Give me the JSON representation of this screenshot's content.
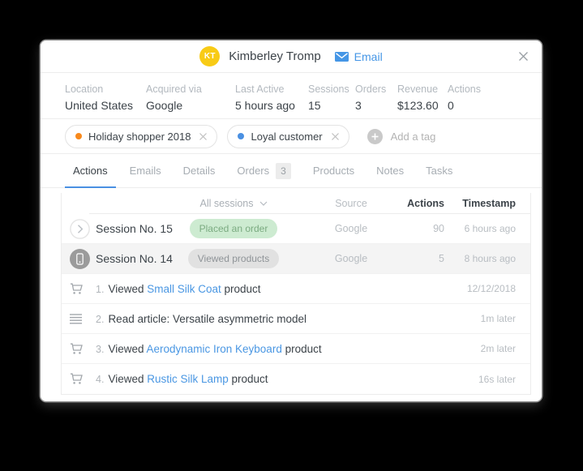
{
  "header": {
    "avatar_initials": "KT",
    "name": "Kimberley Tromp",
    "email_label": "Email"
  },
  "stats": [
    {
      "label": "Location",
      "value": "United States"
    },
    {
      "label": "Acquired via",
      "value": "Google"
    },
    {
      "label": "Last Active",
      "value": "5 hours ago"
    },
    {
      "label": "Sessions",
      "value": "15"
    },
    {
      "label": "Orders",
      "value": "3"
    },
    {
      "label": "Revenue",
      "value": "$123.60"
    },
    {
      "label": "Actions",
      "value": "0"
    }
  ],
  "tags": {
    "items": [
      {
        "label": "Holiday shopper 2018",
        "dot_color": "#f8891c"
      },
      {
        "label": "Loyal customer",
        "dot_color": "#4a90e2"
      }
    ],
    "add_label": "Add a tag"
  },
  "tabs": [
    {
      "label": "Actions",
      "active": true
    },
    {
      "label": "Emails"
    },
    {
      "label": "Details"
    },
    {
      "label": "Orders",
      "badge": "3"
    },
    {
      "label": "Products"
    },
    {
      "label": "Notes"
    },
    {
      "label": "Tasks"
    }
  ],
  "table": {
    "filter_label": "All sessions",
    "headers": {
      "source": "Source",
      "actions": "Actions",
      "timestamp": "Timestamp"
    },
    "sessions": [
      {
        "title": "Session No. 15",
        "badge": "Placed an order",
        "badge_type": "green",
        "source": "Google",
        "actions": "90",
        "timestamp": "6 hours ago",
        "selected": false
      },
      {
        "title": "Session No. 14",
        "badge": "Viewed products",
        "badge_type": "gray",
        "source": "Google",
        "actions": "5",
        "timestamp": "8 hours ago",
        "selected": true
      }
    ],
    "events": [
      {
        "num": "1.",
        "pre": "Viewed ",
        "link": "Small Silk Coat",
        "post": " product",
        "timestamp": "12/12/2018"
      },
      {
        "num": "2.",
        "pre": "Read article: Versatile asymmetric model",
        "link": "",
        "post": "",
        "timestamp": "1m later"
      },
      {
        "num": "3.",
        "pre": "Viewed ",
        "link": "Aerodynamic Iron Keyboard",
        "post": " product",
        "timestamp": "2m later"
      },
      {
        "num": "4.",
        "pre": "Viewed ",
        "link": "Rustic Silk Lamp",
        "post": " product",
        "timestamp": "16s later"
      }
    ]
  },
  "colors": {
    "accent_blue": "#4596e6",
    "link_blue": "#4a97e3",
    "tab_underline": "#4a90e2",
    "avatar_yellow": "#f8cb16",
    "badge_green_bg": "#cdebd1",
    "badge_green_text": "#7bab81",
    "badge_gray_bg": "#e1e1e1",
    "tag_dot_orange": "#f8891c",
    "tag_dot_blue": "#4a90e2",
    "selected_row_bg": "#f4f4f4"
  }
}
